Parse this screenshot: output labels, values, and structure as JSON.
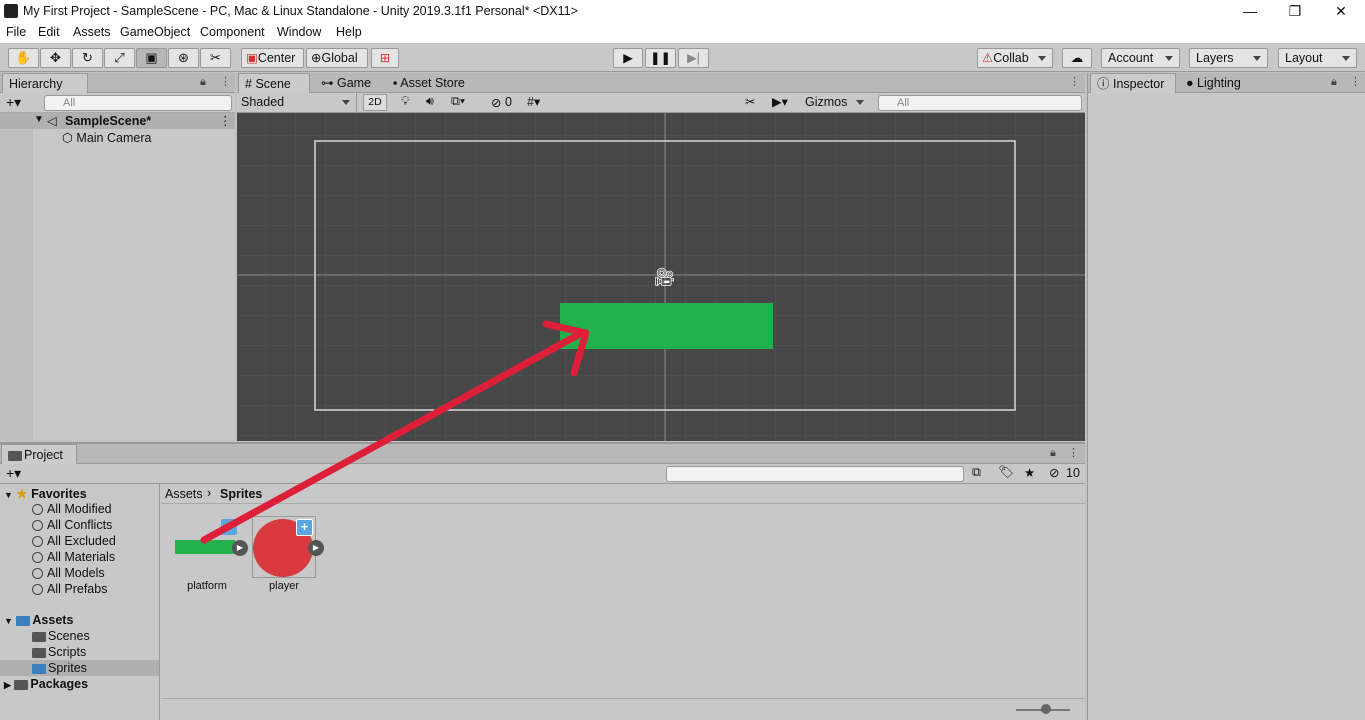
{
  "window": {
    "title": "My First Project - SampleScene - PC, Mac & Linux Standalone - Unity 2019.3.1f1 Personal* <DX11>",
    "controls": [
      "—",
      "❐",
      "✕"
    ]
  },
  "menu": [
    "File",
    "Edit",
    "Assets",
    "GameObject",
    "Component",
    "Window",
    "Help"
  ],
  "toolbar": {
    "pivot": "Center",
    "space": "Global",
    "collab": "Collab",
    "account": "Account",
    "layers": "Layers",
    "layout": "Layout"
  },
  "hierarchy": {
    "tab": "Hierarchy",
    "search_placeholder": "All",
    "scene": "SampleScene*",
    "items": [
      "Main Camera"
    ]
  },
  "scene_view": {
    "tabs": [
      "Scene",
      "Game",
      "Asset Store"
    ],
    "shading": "Shaded",
    "mode_2d": "2D",
    "hidden_count": "0",
    "gizmos": "Gizmos",
    "search_placeholder": "All",
    "platform_color": "#22b14c"
  },
  "inspector": {
    "tabs": [
      "Inspector",
      "Lighting"
    ]
  },
  "project": {
    "tab": "Project",
    "hidden_count": "10",
    "favorites": {
      "label": "Favorites",
      "items": [
        "All Modified",
        "All Conflicts",
        "All Excluded",
        "All Materials",
        "All Models",
        "All Prefabs"
      ]
    },
    "assets": {
      "label": "Assets",
      "items": [
        "Scenes",
        "Scripts",
        "Sprites"
      ]
    },
    "packages": "Packages",
    "breadcrumb": [
      "Assets",
      "Sprites"
    ],
    "files": [
      {
        "name": "platform",
        "color": "#22b14c"
      },
      {
        "name": "player",
        "color": "#d83a3f"
      }
    ]
  },
  "annotation_color": "#dd1f3a"
}
